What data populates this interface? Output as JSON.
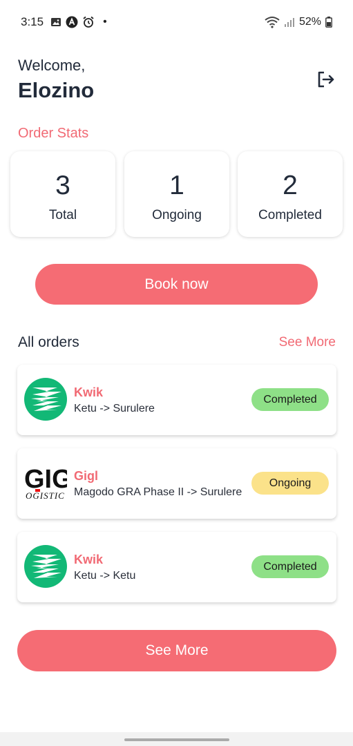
{
  "status_bar": {
    "time": "3:15",
    "dot": "•",
    "battery": "52%",
    "icons": [
      "image-icon",
      "a-circle-icon",
      "alarm-icon",
      "wifi-icon",
      "signal-icon",
      "battery-icon"
    ]
  },
  "header": {
    "welcome": "Welcome,",
    "username": "Elozino",
    "logout_icon": "logout-icon"
  },
  "stats": {
    "title": "Order Stats",
    "total": {
      "value": "3",
      "label": "Total"
    },
    "ongoing": {
      "value": "1",
      "label": "Ongoing"
    },
    "completed": {
      "value": "2",
      "label": "Completed"
    }
  },
  "book_button": "Book now",
  "orders": {
    "title": "All orders",
    "see_more_link": "See More",
    "items": [
      {
        "name": "Kwik",
        "route": "Ketu -> Surulere",
        "status": "Completed",
        "logo": "kwik-logo"
      },
      {
        "name": "Gigl",
        "route": "Magodo GRA Phase II -> Surulere",
        "status": "Ongoing",
        "logo": "gigl-logo",
        "logo_text_1": "GIG",
        "logo_text_2": "OGISTIC"
      },
      {
        "name": "Kwik",
        "route": "Ketu -> Ketu",
        "status": "Completed",
        "logo": "kwik-logo"
      }
    ]
  },
  "see_more_button": "See More",
  "colors": {
    "accent": "#f56c74",
    "completed": "#8ee087",
    "ongoing": "#fbe28a",
    "text_dark": "#222b3a",
    "kwik_green": "#12b876"
  }
}
